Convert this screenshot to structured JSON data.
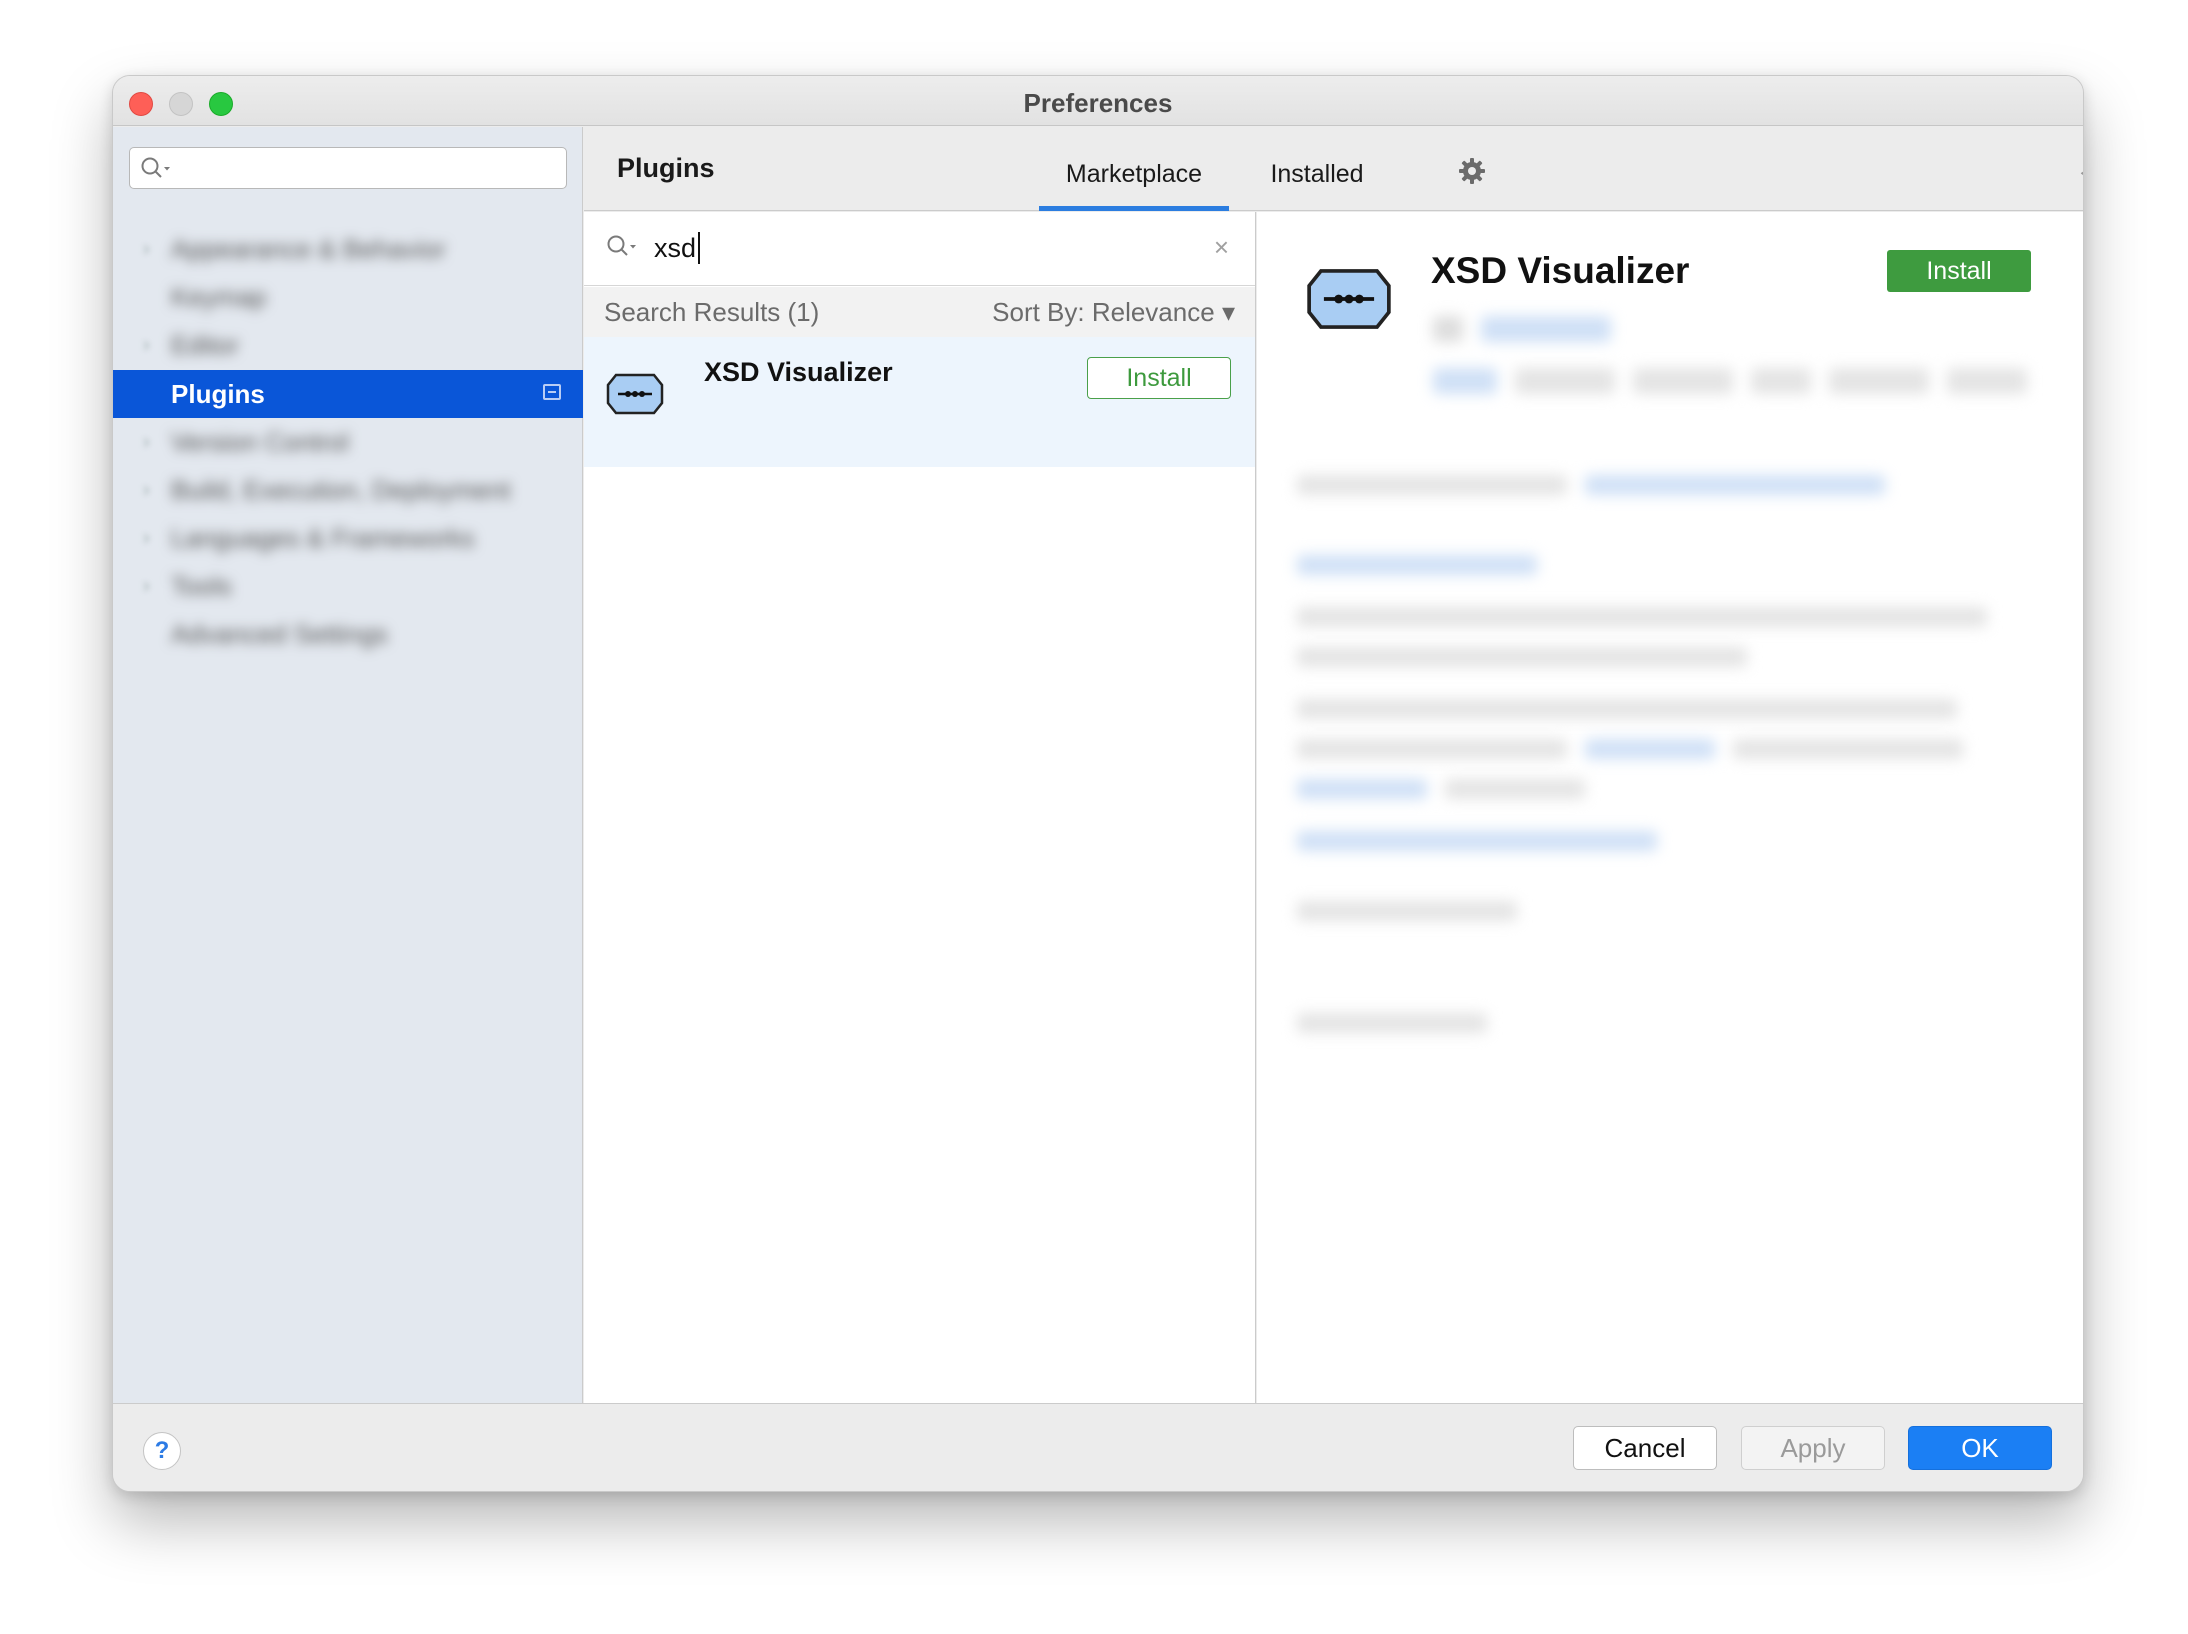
{
  "window": {
    "title": "Preferences"
  },
  "sidebar": {
    "search_placeholder": "",
    "items": [
      {
        "label": "Appearance & Behavior",
        "blurred": true
      },
      {
        "label": "Keymap",
        "blurred": true
      },
      {
        "label": "Editor",
        "blurred": true
      },
      {
        "label": "Plugins",
        "active": true
      },
      {
        "label": "Version Control",
        "blurred": true
      },
      {
        "label": "Build, Execution, Deployment",
        "blurred": true
      },
      {
        "label": "Languages & Frameworks",
        "blurred": true
      },
      {
        "label": "Tools",
        "blurred": true
      },
      {
        "label": "Advanced Settings",
        "blurred": true
      }
    ]
  },
  "header": {
    "title": "Plugins",
    "tabs": [
      {
        "label": "Marketplace",
        "active": true
      },
      {
        "label": "Installed"
      }
    ],
    "back_arrow": "←",
    "forward_arrow": "→"
  },
  "search": {
    "value": "xsd",
    "clear": "×"
  },
  "results": {
    "count_label": "Search Results (1)",
    "sort_label": "Sort By: Relevance",
    "sort_caret": "▾",
    "items": [
      {
        "name": "XSD Visualizer",
        "action": "Install"
      }
    ]
  },
  "detail": {
    "name": "XSD Visualizer",
    "action": "Install"
  },
  "footer": {
    "help": "?",
    "cancel": "Cancel",
    "apply": "Apply",
    "ok": "OK"
  },
  "colors": {
    "accent": "#0a56d8",
    "install_green": "#3e9b3f",
    "ok_blue": "#1b7ff4",
    "tab_underline": "#2b7de0"
  },
  "icons": {
    "search": "search-icon",
    "gear": "gear-icon",
    "plugin_logo": "xsd-plugin-logo-icon",
    "help": "help-icon"
  }
}
